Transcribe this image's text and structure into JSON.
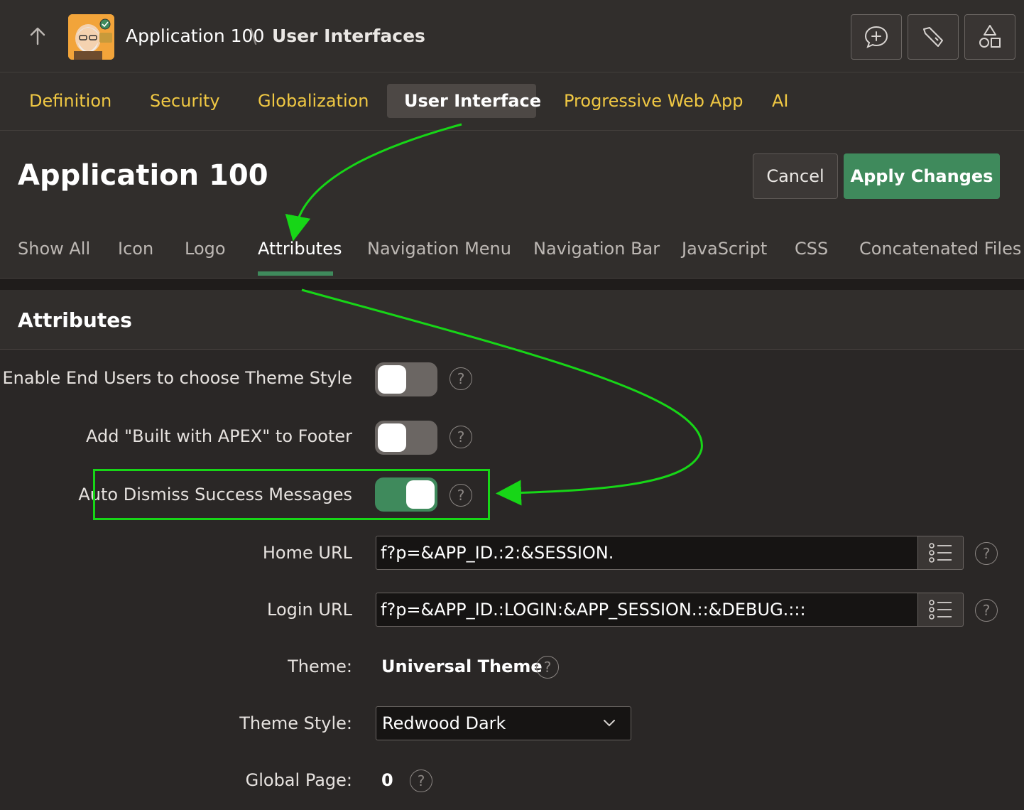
{
  "header": {
    "breadcrumb_app": "Application 100",
    "breadcrumb_separator": "\\",
    "breadcrumb_page": "User Interfaces",
    "icons": [
      "up-arrow-icon",
      "app-logo",
      "feedback-icon",
      "developer-tools-icon",
      "shared-components-icon"
    ]
  },
  "tabs": [
    {
      "label": "Definition",
      "active": false
    },
    {
      "label": "Security",
      "active": false
    },
    {
      "label": "Globalization",
      "active": false
    },
    {
      "label": "User Interface",
      "active": true
    },
    {
      "label": "Progressive Web App",
      "active": false
    },
    {
      "label": "AI",
      "active": false
    }
  ],
  "page": {
    "title": "Application 100",
    "cancel_label": "Cancel",
    "apply_label": "Apply Changes"
  },
  "subtabs": [
    {
      "label": "Show All",
      "active": false
    },
    {
      "label": "Icon",
      "active": false
    },
    {
      "label": "Logo",
      "active": false
    },
    {
      "label": "Attributes",
      "active": true
    },
    {
      "label": "Navigation Menu",
      "active": false
    },
    {
      "label": "Navigation Bar",
      "active": false
    },
    {
      "label": "JavaScript",
      "active": false
    },
    {
      "label": "CSS",
      "active": false
    },
    {
      "label": "Concatenated Files",
      "active": false
    }
  ],
  "region": {
    "title": "Attributes",
    "fields": {
      "theme_style_choice": {
        "label": "Enable End Users to choose Theme Style",
        "on": false
      },
      "built_with_apex": {
        "label": "Add \"Built with APEX\" to Footer",
        "on": false
      },
      "auto_dismiss": {
        "label": "Auto Dismiss Success Messages",
        "on": true
      },
      "home_url": {
        "label": "Home URL",
        "value": "f?p=&APP_ID.:2:&SESSION."
      },
      "login_url": {
        "label": "Login URL",
        "value": "f?p=&APP_ID.:LOGIN:&APP_SESSION.::&DEBUG.:::"
      },
      "theme": {
        "label": "Theme:",
        "value": "Universal Theme"
      },
      "theme_style": {
        "label": "Theme Style:",
        "value": "Redwood Dark"
      },
      "global_page": {
        "label": "Global Page:",
        "value": "0"
      }
    }
  },
  "help_glyph": "?",
  "colors": {
    "accent_green": "#3f8a5c",
    "tab_yellow": "#f0c843",
    "annotation_green": "#17d617"
  }
}
